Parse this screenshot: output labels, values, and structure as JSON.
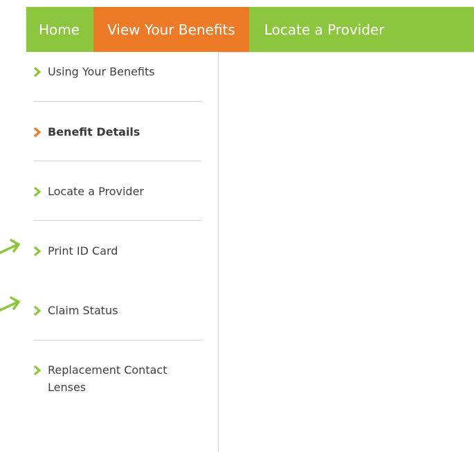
{
  "colors": {
    "nav_green": "#8cc63f",
    "nav_active_orange": "#ec7a26",
    "chevron_green": "#8cc63f",
    "chevron_orange": "#ec7a26",
    "annotation_arrow_green": "#8cc63f"
  },
  "topnav": {
    "items": [
      {
        "label": "Home",
        "active": false
      },
      {
        "label": "View Your Benefits",
        "active": true
      },
      {
        "label": "Locate a Provider",
        "active": false
      }
    ]
  },
  "sidebar": {
    "items": [
      {
        "label": "Using Your Benefits",
        "active": false,
        "icon": "chevron-right-icon"
      },
      {
        "label": "Benefit Details",
        "active": true,
        "icon": "chevron-right-icon"
      },
      {
        "label": "Locate a Provider",
        "active": false,
        "icon": "chevron-right-icon"
      },
      {
        "label": "Print ID Card",
        "active": false,
        "icon": "chevron-right-icon",
        "annotated": true
      },
      {
        "label": "Claim Status",
        "active": false,
        "icon": "chevron-right-icon",
        "annotated": true
      },
      {
        "label": "Replacement Contact Lenses",
        "active": false,
        "icon": "chevron-right-icon"
      }
    ]
  }
}
